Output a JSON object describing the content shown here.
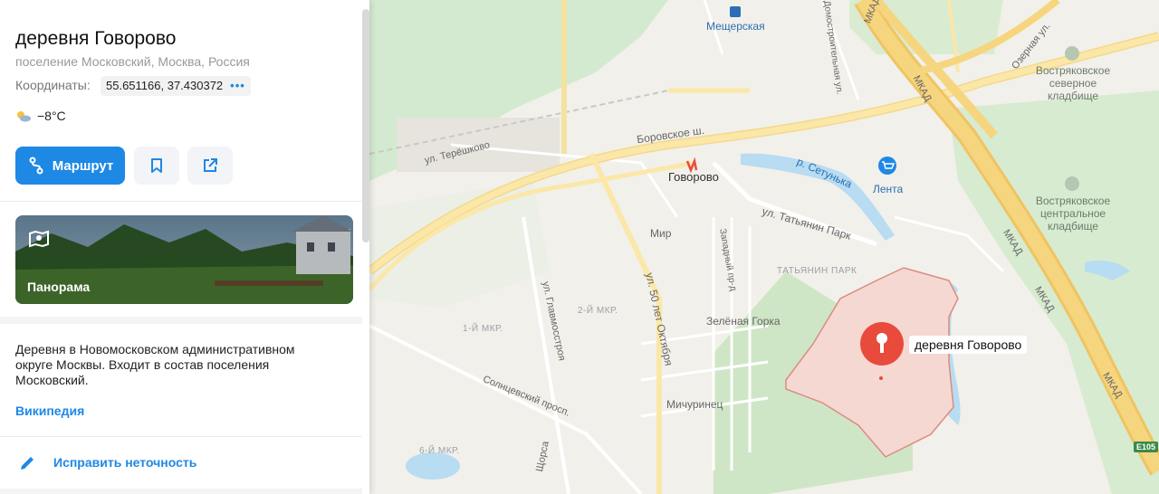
{
  "place": {
    "title": "деревня Говорово",
    "subtitle": "поселение Московский, Москва, Россия",
    "coords_label": "Координаты:",
    "coords_value": "55.651166, 37.430372",
    "coords_more": "•••",
    "weather": "−8°C",
    "weather_icon": "partly-cloudy-icon"
  },
  "actions": {
    "route_label": "Маршрут",
    "route_icon": "route-icon",
    "bookmark_icon": "bookmark-icon",
    "share_icon": "share-icon"
  },
  "panorama": {
    "label": "Панорама",
    "icon": "panorama-icon"
  },
  "description": {
    "text": "Деревня в Новомосковском административном округе Москвы. Входит в состав поселения Московский.",
    "wiki_link": "Википедия"
  },
  "fix": {
    "label": "Исправить неточность",
    "icon": "pencil-icon"
  },
  "map": {
    "labels": {
      "mescherskaya": "Мещерская",
      "borovskoe": "Боровское ш.",
      "tereshkovo": "ул. Терёшково",
      "govorovo_metro": "Говорово",
      "setun": "р. Сетунька",
      "lenta": "Лента",
      "tatyanin_street": "ул. Татьянин Парк",
      "tatyanin_district": "ТАТЬЯНИН ПАРК",
      "mir": "Мир",
      "zapadny": "Западный пр-д",
      "zelenaya_gorka": "Зелёная Горка",
      "glavmosstroya": "ул. Главмосстроя",
      "mkr2": "2-Й МКР.",
      "mkr1": "1-Й МКР.",
      "mkr6": "6-Й МКР.",
      "let50": "ул. 50 лет Октября",
      "solntsevsky": "Солнцевский просп.",
      "michurinets": "Мичуринец",
      "domostroit": "Домостроительная ул.",
      "ozernaya": "Озерная ул.",
      "mkad_top": "МКАД",
      "mkad1": "МКАД",
      "mkad2": "МКАД",
      "mkad3": "МКАД",
      "mkad4": "МКАД",
      "vostr_north": "Востряковское северное кладбище",
      "vostr_central": "Востряковское центральное кладбище",
      "pin": "деревня Говорово",
      "e105": "E105",
      "shorsa": "Щорса"
    },
    "colors": {
      "mkad": "#f6d37a",
      "road_major": "#fbe9a6",
      "water": "#b3d9f0",
      "forest": "#cfe8c4",
      "highlight": "#f8d6d0",
      "pin": "#e84b3c",
      "accent": "#1e88e5"
    }
  }
}
